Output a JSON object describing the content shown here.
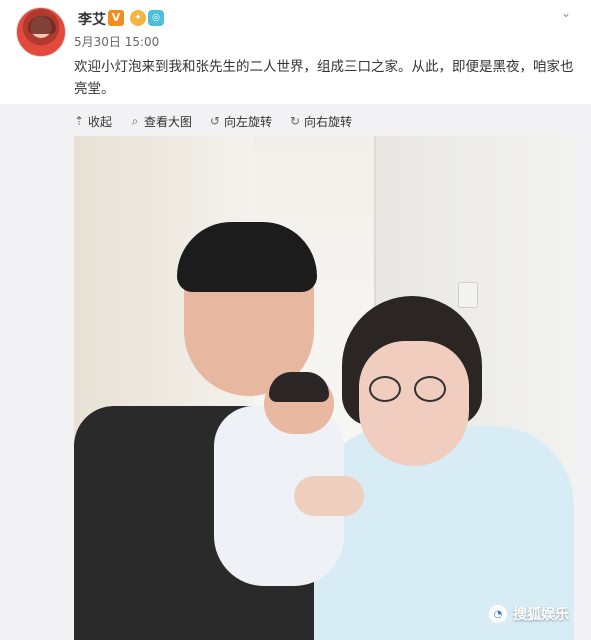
{
  "post": {
    "author": "李艾",
    "badges": {
      "verified": "V"
    },
    "timestamp": "5月30日 15:00",
    "content": "欢迎小灯泡来到我和张先生的二人世界，组成三口之家。从此，即便是黑夜，咱家也亮堂。"
  },
  "toolbar": {
    "collapse": "收起",
    "view_large": "查看大图",
    "rotate_left": "向左旋转",
    "rotate_right": "向右旋转"
  },
  "watermark": {
    "text": "搜狐娱乐"
  },
  "icons": {
    "collapse": "collapse-icon",
    "view_large": "magnifier-icon",
    "rotate_left": "rotate-left-icon",
    "rotate_right": "rotate-right-icon",
    "menu": "chevron-down-icon"
  },
  "colors": {
    "text": "#333333",
    "meta": "#666666",
    "vip": "#f48d1c"
  }
}
